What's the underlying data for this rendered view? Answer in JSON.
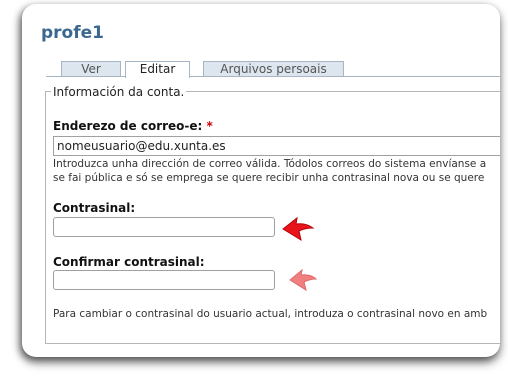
{
  "page": {
    "title": "profe1"
  },
  "tabs": [
    {
      "label": "Ver",
      "active": false
    },
    {
      "label": "Editar",
      "active": true
    },
    {
      "label": "Arquivos persoais",
      "active": false
    }
  ],
  "fieldset": {
    "legend": "Información da conta."
  },
  "email": {
    "label": "Enderezo de correo-e:",
    "required_mark": "*",
    "value": "nomeusuario@edu.xunta.es",
    "description_line1": "Introduzca unha dirección de correo válida. Tódolos correos do sistema envíanse a",
    "description_line2": "se fai pública e só se emprega se quere recibir unha contrasinal nova ou se quere"
  },
  "password": {
    "label": "Contrasinal:",
    "value": ""
  },
  "confirm_password": {
    "label": "Confirmar contrasinal:",
    "value": ""
  },
  "password_help": "Para cambiar o contrasinal do usuario actual, introduza o contrasinal novo en amb",
  "colors": {
    "title": "#3a6890",
    "arrow_primary": "#e8141c",
    "arrow_secondary": "#f08080",
    "required": "#cc0000"
  },
  "icons": [
    "arrow-left-icon",
    "arrow-left-faded-icon"
  ]
}
